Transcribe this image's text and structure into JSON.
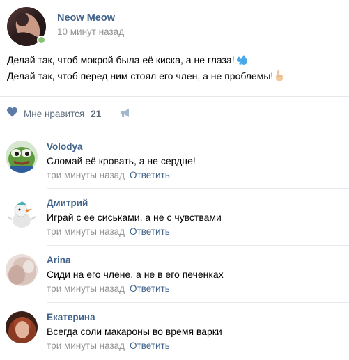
{
  "post": {
    "author": "Neow Meow",
    "time": "10 минут назад",
    "lines": [
      "Делай так, чтоб мокрой была её киска, а не глаза!",
      "Делай так, чтоб перед ним стоял его член, а не проблемы!"
    ],
    "line_emoji": [
      "sweat-droplets-icon",
      "pointing-up-icon"
    ]
  },
  "actions": {
    "like_label": "Мне нравится",
    "like_count": "21",
    "like_icon": "heart-icon",
    "share_icon": "megaphone-icon"
  },
  "comments": [
    {
      "name": "Volodya",
      "text": "Сломай её кровать, а не сердце!",
      "time": "три минуты назад",
      "reply": "Ответить"
    },
    {
      "name": "Дмитрий",
      "text": "Играй с ее сиськами, а не с чувствами",
      "time": "три минуты назад",
      "reply": "Ответить"
    },
    {
      "name": "Arina",
      "text": "Сиди на его члене, а не в его печенках",
      "time": "три минуты назад",
      "reply": "Ответить"
    },
    {
      "name": "Екатерина",
      "text": "Всегда соли макароны во время варки",
      "time": "три минуты назад",
      "reply": "Ответить"
    }
  ],
  "colors": {
    "link": "#42648b",
    "meta": "#939393",
    "online": "#8ac176",
    "action": "#5b6a7c"
  }
}
